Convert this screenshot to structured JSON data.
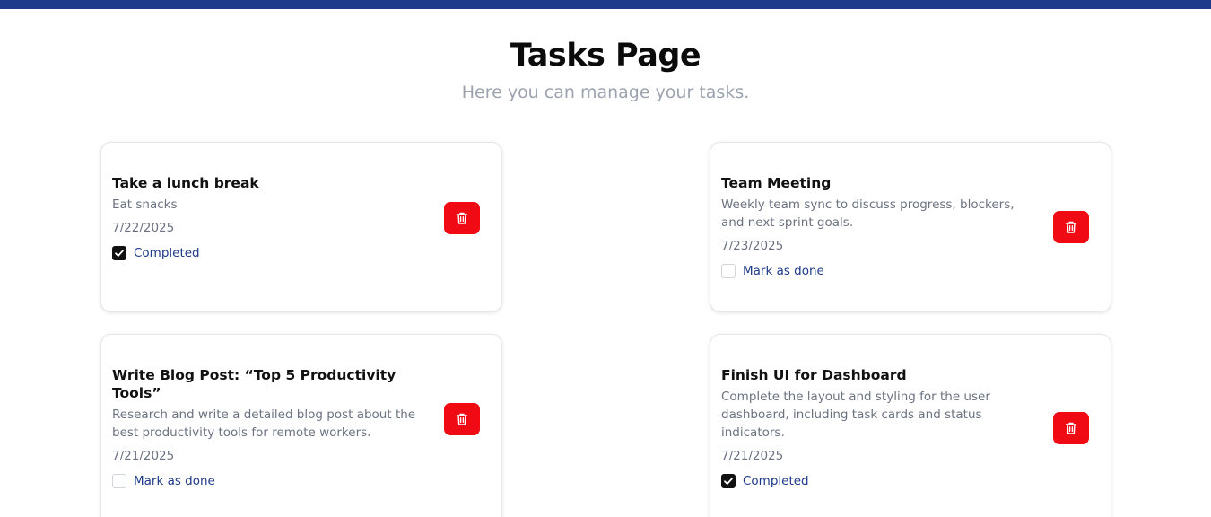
{
  "header": {
    "title": "Tasks Page",
    "subtitle": "Here you can manage your tasks."
  },
  "colors": {
    "accent": "#1e3a8a",
    "delete": "#ef0a14"
  },
  "tasks": [
    {
      "title": "Take a lunch break",
      "description": "Eat snacks",
      "date": "7/22/2025",
      "completed": true,
      "status_label": "Completed"
    },
    {
      "title": "Team Meeting",
      "description": "Weekly team sync to discuss progress, blockers, and next sprint goals.",
      "date": "7/23/2025",
      "completed": false,
      "status_label": "Mark as done"
    },
    {
      "title": "Write Blog Post: “Top 5 Productivity Tools”",
      "description": "Research and write a detailed blog post about the best productivity tools for remote workers.",
      "date": "7/21/2025",
      "completed": false,
      "status_label": "Mark as done"
    },
    {
      "title": "Finish UI for Dashboard",
      "description": "Complete the layout and styling for the user dashboard, including task cards and status indicators.",
      "date": "7/21/2025",
      "completed": true,
      "status_label": "Completed"
    }
  ],
  "icons": {
    "delete": "trash-icon",
    "check": "checkmark-icon"
  }
}
